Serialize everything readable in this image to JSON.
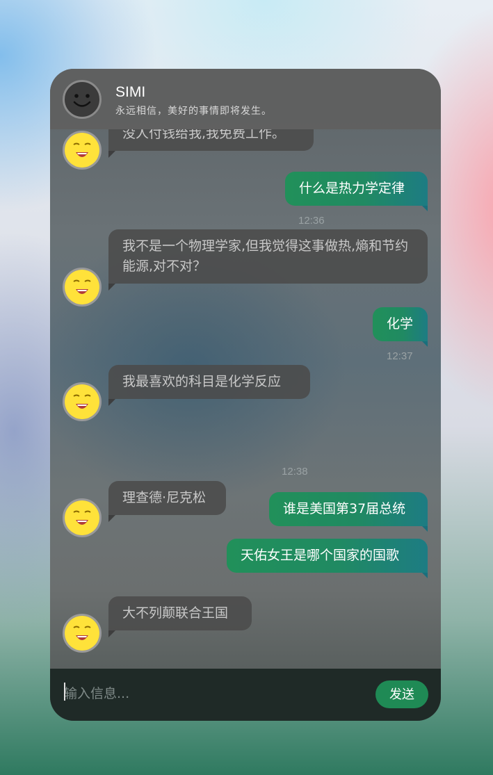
{
  "header": {
    "name": "SIMI",
    "status": "永远相信，美好的事情即将发生。"
  },
  "messages": [
    {
      "sender": "bot",
      "text": "没人付钱给我,我免费工作。"
    },
    {
      "sender": "user",
      "text": "什么是热力学定律",
      "time": "12:36"
    },
    {
      "sender": "bot",
      "text": "我不是一个物理学家,但我觉得这事做热,熵和节约能源,对不对？"
    },
    {
      "sender": "user",
      "text": "化学",
      "time": "12:37"
    },
    {
      "sender": "bot",
      "text": "我最喜欢的科目是化学反应"
    },
    {
      "sender": "user",
      "text": "谁是美国第37届总统",
      "time": "12:38"
    },
    {
      "sender": "bot",
      "text": "理查德·尼克松"
    },
    {
      "sender": "user",
      "text": "天佑女王是哪个国家的国歌"
    },
    {
      "sender": "bot",
      "text": "大不列颠联合王国"
    }
  ],
  "input": {
    "placeholder": "输入信息...",
    "send_label": "发送"
  },
  "colors": {
    "user_bubble": "#21905a",
    "bot_bubble": "#4b4b4b",
    "send_button": "#1f8a55"
  }
}
